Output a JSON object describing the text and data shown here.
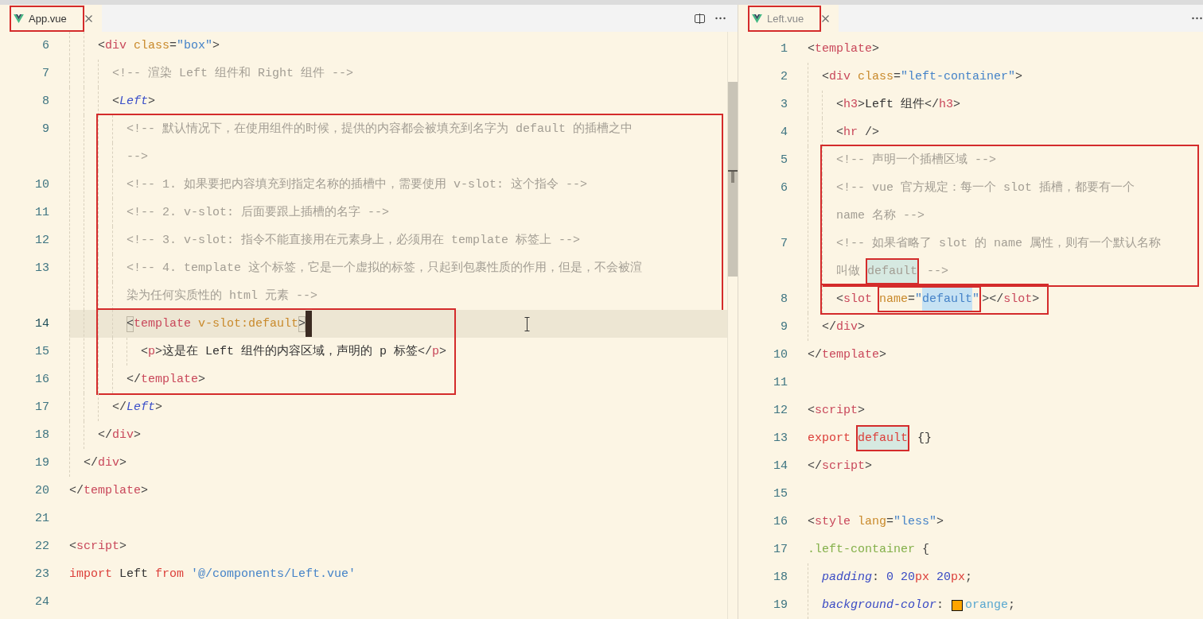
{
  "panes": [
    {
      "focused": true,
      "tabs": [
        {
          "label": "App.vue",
          "selected": true,
          "boxed": true
        }
      ],
      "blocks": [
        {
          "boxed": false,
          "lines": [
            {
              "number": "6",
              "current": false,
              "rows": [
                [
                  {
                    "kind": "punct",
                    "text": "    <"
                  },
                  {
                    "kind": "tag",
                    "text": "div"
                  },
                  {
                    "kind": "attr",
                    "text": " class"
                  },
                  {
                    "kind": "punct",
                    "text": "="
                  },
                  {
                    "kind": "string",
                    "text": "\"box\""
                  },
                  {
                    "kind": "punct",
                    "text": ">"
                  }
                ]
              ]
            },
            {
              "number": "7",
              "current": false,
              "rows": [
                [
                  {
                    "kind": "comment",
                    "text": "      <!-- 渲染 Left 组件和 Right 组件 -->"
                  }
                ]
              ]
            },
            {
              "number": "8",
              "current": false,
              "rows": [
                [
                  {
                    "kind": "punct",
                    "text": "      <"
                  },
                  {
                    "kind": "component",
                    "text": "Left"
                  },
                  {
                    "kind": "punct",
                    "text": ">"
                  }
                ]
              ]
            }
          ]
        },
        {
          "boxed": true,
          "lines": [
            {
              "number": "9",
              "current": false,
              "rows": [
                [
                  {
                    "kind": "comment",
                    "text": "        <!-- 默认情况下，在使用组件的时候，提供的内容都会被填充到名字为 default 的插槽之中"
                  }
                ],
                [
                  {
                    "kind": "comment",
                    "text": "-->"
                  }
                ]
              ]
            },
            {
              "number": "10",
              "current": false,
              "rows": [
                [
                  {
                    "kind": "comment",
                    "text": "        <!-- 1. 如果要把内容填充到指定名称的插槽中，需要使用 v-slot: 这个指令 -->"
                  }
                ]
              ]
            },
            {
              "number": "11",
              "current": false,
              "rows": [
                [
                  {
                    "kind": "comment",
                    "text": "        <!-- 2. v-slot: 后面要跟上插槽的名字 -->"
                  }
                ]
              ]
            },
            {
              "number": "12",
              "current": false,
              "rows": [
                [
                  {
                    "kind": "comment",
                    "text": "        <!-- 3. v-slot: 指令不能直接用在元素身上，必须用在 template 标签上 -->"
                  }
                ]
              ]
            },
            {
              "number": "13",
              "current": false,
              "rows": [
                [
                  {
                    "kind": "comment",
                    "text": "        <!-- 4. template 这个标签，它是一个虚拟的标签，只起到包裹性质的作用，但是，不会被渲"
                  }
                ],
                [
                  {
                    "kind": "comment",
                    "text": "染为任何实质性的 html 元素 -->"
                  }
                ]
              ]
            }
          ]
        },
        {
          "boxed": true,
          "lines": [
            {
              "number": "14",
              "current": true,
              "rows": [
                [
                  {
                    "kind": "punct",
                    "text": "        <",
                    "matched": true
                  },
                  {
                    "kind": "tag",
                    "text": "template"
                  },
                  {
                    "kind": "attr",
                    "text": " v-slot:default"
                  },
                  {
                    "kind": "punct",
                    "text": ">",
                    "matched": true
                  },
                  {
                    "kind": "cursor"
                  }
                ]
              ]
            },
            {
              "number": "15",
              "current": false,
              "rows": [
                [
                  {
                    "kind": "punct",
                    "text": "          <"
                  },
                  {
                    "kind": "tag",
                    "text": "p"
                  },
                  {
                    "kind": "punct",
                    "text": ">"
                  },
                  {
                    "kind": "text",
                    "text": "这是在 Left 组件的内容区域，声明的 p 标签"
                  },
                  {
                    "kind": "punct",
                    "text": "</"
                  },
                  {
                    "kind": "tag",
                    "text": "p"
                  },
                  {
                    "kind": "punct",
                    "text": ">"
                  }
                ]
              ]
            },
            {
              "number": "16",
              "current": false,
              "rows": [
                [
                  {
                    "kind": "punct",
                    "text": "        </"
                  },
                  {
                    "kind": "tag",
                    "text": "template"
                  },
                  {
                    "kind": "punct",
                    "text": ">"
                  }
                ]
              ]
            }
          ]
        },
        {
          "boxed": false,
          "lines": [
            {
              "number": "17",
              "current": false,
              "rows": [
                [
                  {
                    "kind": "punct",
                    "text": "      </"
                  },
                  {
                    "kind": "component",
                    "text": "Left"
                  },
                  {
                    "kind": "punct",
                    "text": ">"
                  }
                ]
              ]
            },
            {
              "number": "18",
              "current": false,
              "rows": [
                [
                  {
                    "kind": "punct",
                    "text": "    </"
                  },
                  {
                    "kind": "tag",
                    "text": "div"
                  },
                  {
                    "kind": "punct",
                    "text": ">"
                  }
                ]
              ]
            },
            {
              "number": "19",
              "current": false,
              "rows": [
                [
                  {
                    "kind": "punct",
                    "text": "  </"
                  },
                  {
                    "kind": "tag",
                    "text": "div"
                  },
                  {
                    "kind": "punct",
                    "text": ">"
                  }
                ]
              ]
            },
            {
              "number": "20",
              "current": false,
              "rows": [
                [
                  {
                    "kind": "punct",
                    "text": "</"
                  },
                  {
                    "kind": "tag",
                    "text": "template"
                  },
                  {
                    "kind": "punct",
                    "text": ">"
                  }
                ]
              ]
            },
            {
              "number": "21",
              "current": false
            },
            {
              "number": "22",
              "current": false,
              "rows": [
                [
                  {
                    "kind": "punct",
                    "text": "<"
                  },
                  {
                    "kind": "tag",
                    "text": "script"
                  },
                  {
                    "kind": "punct",
                    "text": ">"
                  }
                ]
              ]
            },
            {
              "number": "23",
              "current": false,
              "rows": [
                [
                  {
                    "kind": "keyword",
                    "text": "import"
                  },
                  {
                    "kind": "text",
                    "text": " Left "
                  },
                  {
                    "kind": "keyword",
                    "text": "from"
                  },
                  {
                    "kind": "string",
                    "text": " '@/components/Left.vue'"
                  }
                ]
              ]
            },
            {
              "number": "24",
              "current": false
            }
          ]
        }
      ]
    },
    {
      "focused": false,
      "tabs": [
        {
          "label": "Left.vue",
          "selected": true,
          "boxed": true
        }
      ],
      "blocks": [
        {
          "boxed": false,
          "lines": [
            {
              "number": "1",
              "current": false,
              "rows": [
                [
                  {
                    "kind": "punct",
                    "text": "<"
                  },
                  {
                    "kind": "tag",
                    "text": "template"
                  },
                  {
                    "kind": "punct",
                    "text": ">"
                  }
                ]
              ]
            },
            {
              "number": "2",
              "current": false,
              "rows": [
                [
                  {
                    "kind": "punct",
                    "text": "  <"
                  },
                  {
                    "kind": "tag",
                    "text": "div"
                  },
                  {
                    "kind": "attr",
                    "text": " class"
                  },
                  {
                    "kind": "punct",
                    "text": "="
                  },
                  {
                    "kind": "string",
                    "text": "\"left-container\""
                  },
                  {
                    "kind": "punct",
                    "text": ">"
                  }
                ]
              ]
            },
            {
              "number": "3",
              "current": false,
              "rows": [
                [
                  {
                    "kind": "punct",
                    "text": "    <"
                  },
                  {
                    "kind": "tag",
                    "text": "h3"
                  },
                  {
                    "kind": "punct",
                    "text": ">"
                  },
                  {
                    "kind": "text",
                    "text": "Left 组件"
                  },
                  {
                    "kind": "punct",
                    "text": "</"
                  },
                  {
                    "kind": "tag",
                    "text": "h3"
                  },
                  {
                    "kind": "punct",
                    "text": ">"
                  }
                ]
              ]
            },
            {
              "number": "4",
              "current": false,
              "rows": [
                [
                  {
                    "kind": "punct",
                    "text": "    <"
                  },
                  {
                    "kind": "tag",
                    "text": "hr"
                  },
                  {
                    "kind": "punct",
                    "text": " />"
                  }
                ]
              ]
            }
          ]
        },
        {
          "boxed": true,
          "lines": [
            {
              "number": "5",
              "current": false,
              "rows": [
                [
                  {
                    "kind": "comment",
                    "text": "    <!-- 声明一个插槽区域 -->"
                  }
                ]
              ]
            },
            {
              "number": "6",
              "current": false,
              "rows": [
                [
                  {
                    "kind": "comment",
                    "text": "    <!-- vue 官方规定：每一个 slot 插槽，都要有一个"
                  }
                ],
                [
                  {
                    "kind": "comment",
                    "text": "name 名称 -->"
                  }
                ]
              ]
            },
            {
              "number": "7",
              "current": false,
              "rows": [
                [
                  {
                    "kind": "comment",
                    "text": "    <!-- 如果省略了 slot 的 name 属性，则有一个默认名称"
                  }
                ],
                [
                  {
                    "kind": "comment",
                    "text": "叫做 "
                  },
                  {
                    "kind": "comment",
                    "text": "default",
                    "boxed": true,
                    "highlighted": true
                  },
                  {
                    "kind": "comment",
                    "text": " -->"
                  }
                ]
              ]
            }
          ]
        },
        {
          "boxed": true,
          "lines": [
            {
              "number": "8",
              "current": false,
              "rows": [
                [
                  {
                    "kind": "punct",
                    "text": "    <"
                  },
                  {
                    "kind": "tag",
                    "text": "slot"
                  },
                  {
                    "kind": "text",
                    "text": " "
                  },
                  {
                    "kind": "group",
                    "boxed": true,
                    "tokens": [
                      {
                        "kind": "attr",
                        "text": "name"
                      },
                      {
                        "kind": "punct",
                        "text": "="
                      },
                      {
                        "kind": "string",
                        "text": "\""
                      },
                      {
                        "kind": "string",
                        "text": "default",
                        "selection": true
                      },
                      {
                        "kind": "string",
                        "text": "\""
                      }
                    ]
                  },
                  {
                    "kind": "punct",
                    "text": "></"
                  },
                  {
                    "kind": "tag",
                    "text": "slot"
                  },
                  {
                    "kind": "punct",
                    "text": ">"
                  }
                ]
              ]
            }
          ]
        },
        {
          "boxed": false,
          "lines": [
            {
              "number": "9",
              "current": false,
              "rows": [
                [
                  {
                    "kind": "punct",
                    "text": "  </"
                  },
                  {
                    "kind": "tag",
                    "text": "div"
                  },
                  {
                    "kind": "punct",
                    "text": ">"
                  }
                ]
              ]
            },
            {
              "number": "10",
              "current": false,
              "rows": [
                [
                  {
                    "kind": "punct",
                    "text": "</"
                  },
                  {
                    "kind": "tag",
                    "text": "template"
                  },
                  {
                    "kind": "punct",
                    "text": ">"
                  }
                ]
              ]
            },
            {
              "number": "11",
              "current": false
            },
            {
              "number": "12",
              "current": false,
              "rows": [
                [
                  {
                    "kind": "punct",
                    "text": "<"
                  },
                  {
                    "kind": "tag",
                    "text": "script"
                  },
                  {
                    "kind": "punct",
                    "text": ">"
                  }
                ]
              ]
            },
            {
              "number": "13",
              "current": false,
              "rows": [
                [
                  {
                    "kind": "keyword",
                    "text": "export"
                  },
                  {
                    "kind": "text",
                    "text": " "
                  },
                  {
                    "kind": "keyword",
                    "text": "default",
                    "boxed": true,
                    "highlighted": true
                  },
                  {
                    "kind": "text",
                    "text": " {}"
                  }
                ]
              ]
            },
            {
              "number": "14",
              "current": false,
              "rows": [
                [
                  {
                    "kind": "punct",
                    "text": "</"
                  },
                  {
                    "kind": "tag",
                    "text": "script"
                  },
                  {
                    "kind": "punct",
                    "text": ">"
                  }
                ]
              ]
            },
            {
              "number": "15",
              "current": false
            },
            {
              "number": "16",
              "current": false,
              "rows": [
                [
                  {
                    "kind": "punct",
                    "text": "<"
                  },
                  {
                    "kind": "tag",
                    "text": "style"
                  },
                  {
                    "kind": "attr",
                    "text": " lang"
                  },
                  {
                    "kind": "punct",
                    "text": "="
                  },
                  {
                    "kind": "string",
                    "text": "\"less\""
                  },
                  {
                    "kind": "punct",
                    "text": ">"
                  }
                ]
              ]
            },
            {
              "number": "17",
              "current": false,
              "rows": [
                [
                  {
                    "kind": "selector",
                    "text": ".left-container"
                  },
                  {
                    "kind": "punct",
                    "text": " {"
                  }
                ]
              ]
            },
            {
              "number": "18",
              "current": false,
              "rows": [
                [
                  {
                    "kind": "property",
                    "text": "  padding"
                  },
                  {
                    "kind": "punct",
                    "text": ": "
                  },
                  {
                    "kind": "number",
                    "text": "0 20"
                  },
                  {
                    "kind": "unit",
                    "text": "px"
                  },
                  {
                    "kind": "number",
                    "text": " 20"
                  },
                  {
                    "kind": "unit",
                    "text": "px"
                  },
                  {
                    "kind": "punct",
                    "text": ";"
                  }
                ]
              ]
            },
            {
              "number": "19",
              "current": false,
              "rows": [
                [
                  {
                    "kind": "property",
                    "text": "  background-color"
                  },
                  {
                    "kind": "punct",
                    "text": ": "
                  },
                  {
                    "kind": "swatch",
                    "color": "#ffa500"
                  },
                  {
                    "kind": "value",
                    "text": "orange"
                  },
                  {
                    "kind": "punct",
                    "text": ";"
                  }
                ]
              ]
            }
          ]
        }
      ]
    }
  ]
}
